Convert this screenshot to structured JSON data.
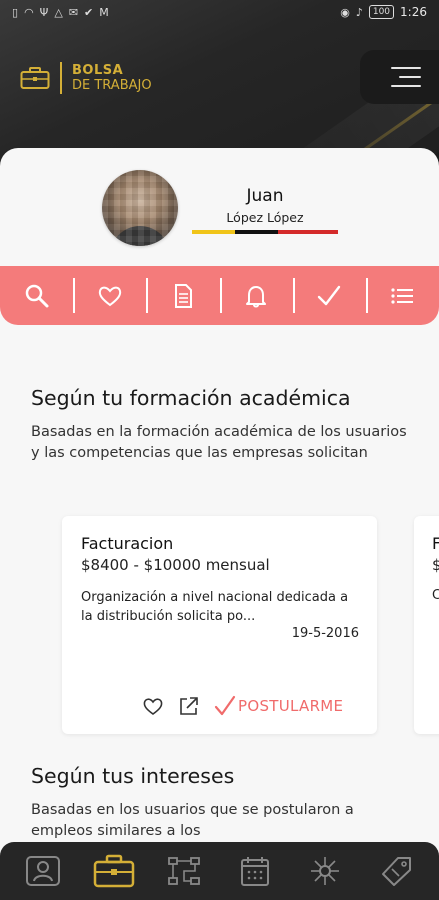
{
  "status_bar": {
    "left_icons": [
      "sim-icon",
      "wifi-icon",
      "usb-icon",
      "drive-icon",
      "mail-icon",
      "check-icon",
      "gmail-icon"
    ],
    "right_icons": [
      "eye-icon",
      "mute-icon",
      "signal-icon"
    ],
    "battery": "100",
    "time": "1:26"
  },
  "header": {
    "logo_line1": "BOLSA",
    "logo_line2": "DE TRABAJO",
    "accent_color": "#d4af37"
  },
  "profile": {
    "name": "Juan",
    "surname": "López López"
  },
  "action_bar": {
    "color": "#f47b7b",
    "items": [
      "search-icon",
      "heart-icon",
      "document-icon",
      "bell-icon",
      "check-icon",
      "list-icon"
    ]
  },
  "sections": [
    {
      "title": "Según tu formación académica",
      "description": "Basadas en la formación académica de los usuarios y las competencias que las empresas solicitan"
    },
    {
      "title": "Según tus intereses",
      "description": "Basadas en los usuarios que se postularon a empleos similares a los"
    }
  ],
  "jobs": [
    {
      "title": "Facturacion",
      "salary": "$8400 - $10000 mensual",
      "description": "Organización a nivel nacional dedicada a la distribución solicita po...",
      "date": "19-5-2016",
      "apply_label": "POSTULARME"
    },
    {
      "title": "F",
      "salary": "$",
      "description": "C"
    }
  ],
  "bottom_nav": {
    "items": [
      "profile-icon",
      "briefcase-icon",
      "flow-icon",
      "calendar-icon",
      "network-icon",
      "tag-icon"
    ],
    "active": "briefcase-icon"
  }
}
